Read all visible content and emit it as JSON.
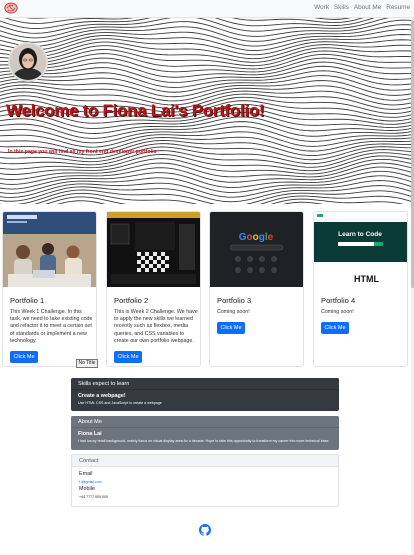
{
  "navbar": {
    "brand_icon": "brain-icon",
    "links": [
      "Work",
      "Skills",
      "About Me",
      "Resume"
    ]
  },
  "hero": {
    "title": "Welcome to Fiona Lai's Portfolio!",
    "subtitle": "In this page you will find all my front end developer portfolio",
    "avatar_icon": "profile-photo"
  },
  "cards": [
    {
      "title": "Portfolio 1",
      "text": "This Week 1 Challenge. In this task, we need to take existing code and refactor it to meet a certain set of standards or implement a new technology.",
      "button": "Click Me",
      "thumb": "group-meeting-photo"
    },
    {
      "title": "Portfolio 2",
      "text": "This is Week 2 Challenge. We have to apply the new skills we learned recently such as flexbox, media queries, and CSS variables to create our own portfolio webpage.",
      "button": "Click Me",
      "thumb": "dark-pattern-site"
    },
    {
      "title": "Portfolio 3",
      "text": "Coming soon!",
      "button": "Click Me",
      "thumb": "google-homepage"
    },
    {
      "title": "Portfolio 4",
      "text": "Coming soon!",
      "button": "Click Me",
      "thumb": "learn-to-code-site"
    }
  ],
  "no_title_label": "No Title",
  "skills": {
    "header": "Skills expect to learn",
    "title": "Create a webpage!",
    "text": "Use HTML CSS and JavaScript to create a webpage"
  },
  "about": {
    "header": "About Me",
    "name": "Fiona Lai",
    "text": "I had luxury retail background, mainly focus on visual display area for a decade. Hope to take this opportunity to transform my career into more technical base."
  },
  "contact": {
    "header": "Contact",
    "email_label": "Email",
    "email_value": "f.l@gmail.com",
    "mobile_label": "Mobile",
    "mobile_value": "+44 7777 000 000"
  },
  "footer": {
    "icon": "github-icon"
  },
  "colors": {
    "accent": "#0d6efd",
    "hero_title": "#b0181b",
    "dark_panel": "#343a40",
    "grey_panel": "#6c757d"
  }
}
